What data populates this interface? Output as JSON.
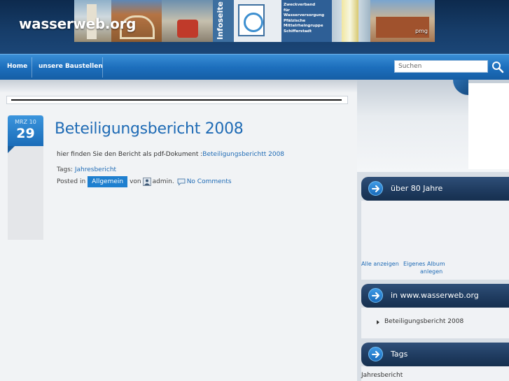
{
  "header": {
    "site_title": "wasserweb.org",
    "banner": {
      "infoseite_label": "Infoseite",
      "org_lines": [
        "Zweckverband",
        "für Wasserversorgung",
        "Pfälzische",
        "Mittelrheingruppe",
        "Schifferstadt"
      ],
      "photo_caption": "pmg"
    }
  },
  "nav": {
    "items": [
      {
        "label": "Home"
      },
      {
        "label": "unsere Baustellen"
      }
    ],
    "search": {
      "placeholder": "Suchen"
    }
  },
  "post": {
    "date_month": "MRZ 10",
    "date_day": "29",
    "title": "Beteiligungsbericht 2008",
    "body_text": "hier finden Sie den Bericht als pdf-Dokument :",
    "body_link": "Beteiligungsberichtt 2008",
    "tags_label": "Tags:",
    "tag": "Jahresbericht",
    "posted_in_label": "Posted in",
    "category": "Allgemein",
    "by_label": "von",
    "author": "admin.",
    "comments": "No Comments"
  },
  "sidebar": {
    "widget1": {
      "title": "über 80 Jahre",
      "links": [
        "Alle anzeigen",
        "Eigenes Album",
        "anlegen"
      ]
    },
    "widget2": {
      "title": "in www.wasserweb.org",
      "items": [
        "Beteiligungsbericht 2008"
      ]
    },
    "widget3": {
      "title": "Tags",
      "items": [
        "Jahresbericht"
      ]
    }
  },
  "colors": {
    "accent_blue": "#1e7fcf",
    "link_blue": "#1f6bb5",
    "header_navy": "#163c68"
  }
}
